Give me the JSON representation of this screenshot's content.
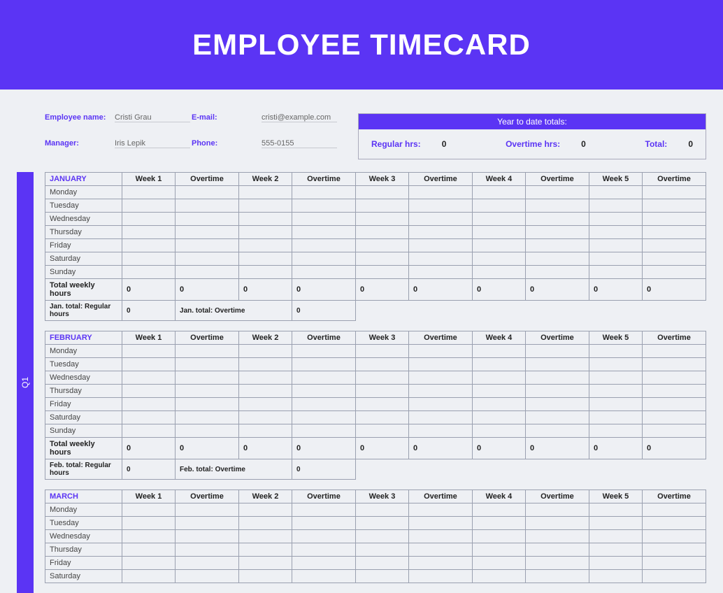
{
  "title": "EMPLOYEE TIMECARD",
  "quarter_label": "Q1",
  "info": {
    "employee_label": "Employee name:",
    "employee_value": "Cristi Grau",
    "email_label": "E-mail:",
    "email_value": "cristi@example.com",
    "manager_label": "Manager:",
    "manager_value": "Iris Lepik",
    "phone_label": "Phone:",
    "phone_value": "555-0155"
  },
  "ytd": {
    "header": "Year to date totals:",
    "regular_label": "Regular hrs:",
    "regular_value": "0",
    "overtime_label": "Overtime hrs:",
    "overtime_value": "0",
    "total_label": "Total:",
    "total_value": "0"
  },
  "columns": {
    "week1": "Week 1",
    "ot1": "Overtime",
    "week2": "Week 2",
    "ot2": "Overtime",
    "week3": "Week 3",
    "ot3": "Overtime",
    "week4": "Week 4",
    "ot4": "Overtime",
    "week5": "Week 5",
    "ot5": "Overtime"
  },
  "days": {
    "mon": "Monday",
    "tue": "Tuesday",
    "wed": "Wednesday",
    "thu": "Thursday",
    "fri": "Friday",
    "sat": "Saturday",
    "sun": "Sunday"
  },
  "total_row_label": "Total weekly hours",
  "zero": "0",
  "months": {
    "jan": {
      "name": "JANUARY",
      "reg_total_label": "Jan. total: Regular hours",
      "ot_total_label": "Jan. total: Overtime"
    },
    "feb": {
      "name": "FEBRUARY",
      "reg_total_label": "Feb. total: Regular hours",
      "ot_total_label": "Feb.  total: Overtime"
    },
    "mar": {
      "name": "MARCH"
    }
  }
}
